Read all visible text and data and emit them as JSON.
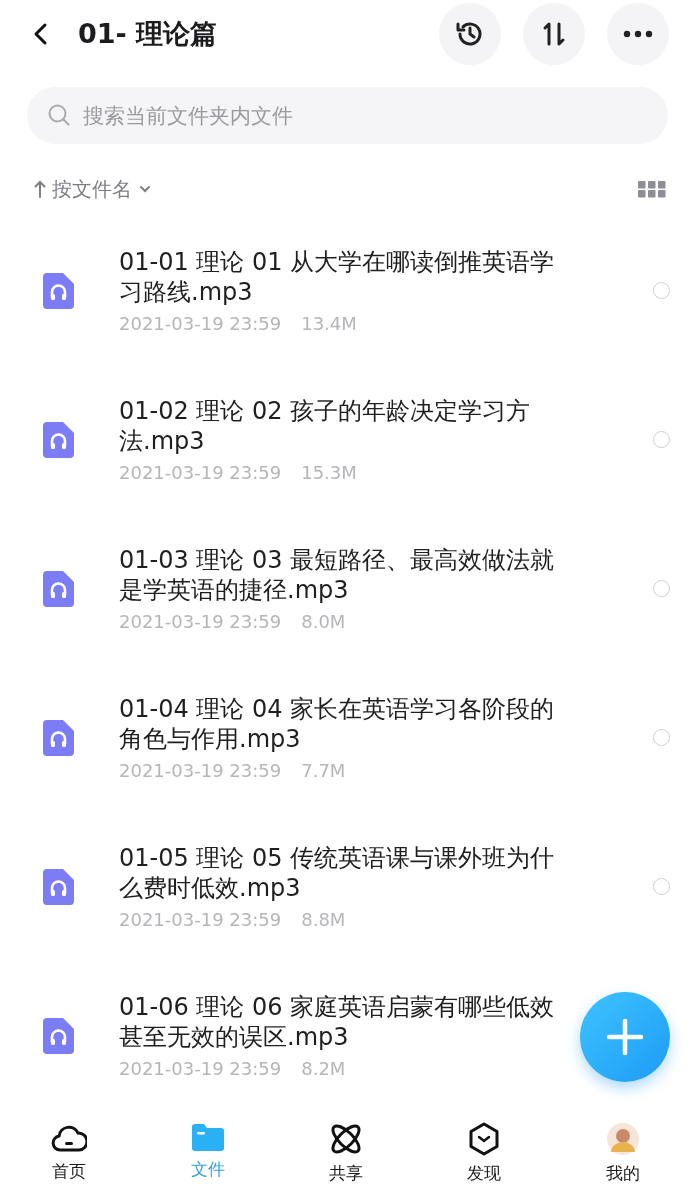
{
  "header": {
    "title": "01- 理论篇"
  },
  "search": {
    "placeholder": "搜索当前文件夹内文件"
  },
  "sort": {
    "label": "按文件名"
  },
  "files": [
    {
      "name": "01-01 理论 01 从大学在哪读倒推英语学习路线.mp3",
      "date": "2021-03-19 23:59",
      "size": "13.4M",
      "selected": false
    },
    {
      "name": "01-02 理论 02 孩子的年龄决定学习方法.mp3",
      "date": "2021-03-19 23:59",
      "size": "15.3M",
      "selected": false
    },
    {
      "name": "01-03 理论 03 最短路径、最高效做法就是学英语的捷径.mp3",
      "date": "2021-03-19 23:59",
      "size": "8.0M",
      "selected": false
    },
    {
      "name": "01-04 理论 04 家长在英语学习各阶段的角色与作用.mp3",
      "date": "2021-03-19 23:59",
      "size": "7.7M",
      "selected": false
    },
    {
      "name": "01-05 理论 05 传统英语课与课外班为什么费时低效.mp3",
      "date": "2021-03-19 23:59",
      "size": "8.8M",
      "selected": false
    },
    {
      "name": "01-06 理论 06 家庭英语启蒙有哪些低效甚至无效的误区.mp3",
      "date": "2021-03-19 23:59",
      "size": "8.2M"
    }
  ],
  "tabs": [
    {
      "kind": "cloud",
      "label": "首页",
      "selected": false
    },
    {
      "kind": "folder",
      "label": "文件",
      "selected": true
    },
    {
      "kind": "orbit",
      "label": "共享",
      "selected": false
    },
    {
      "kind": "hexagon",
      "label": "发现",
      "selected": false
    },
    {
      "kind": "avatar",
      "label": "我的",
      "selected": false
    }
  ]
}
